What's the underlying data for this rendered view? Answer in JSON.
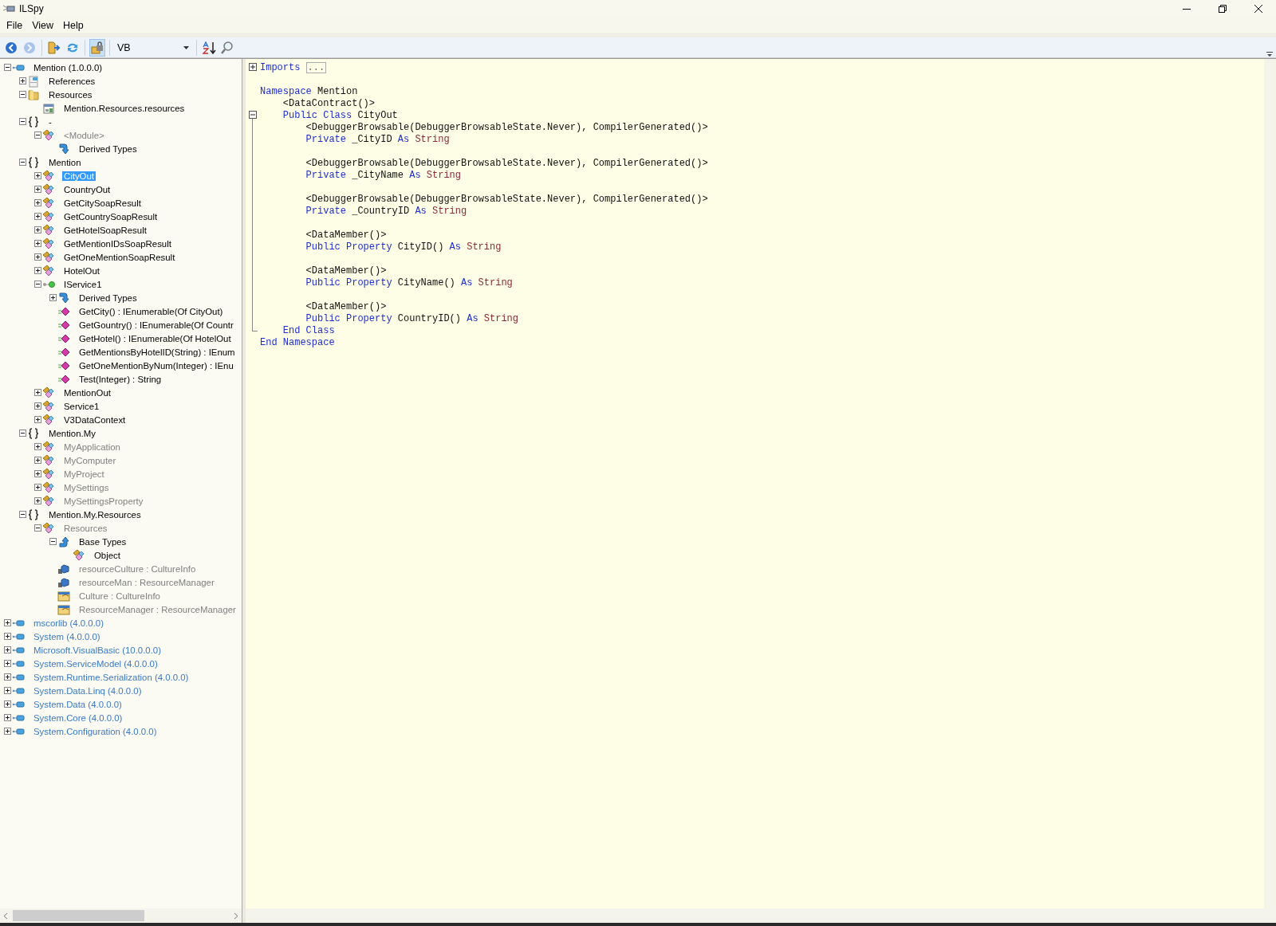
{
  "window": {
    "title": "ILSpy"
  },
  "menu": [
    "File",
    "View",
    "Help"
  ],
  "toolbar": {
    "buttons": [
      {
        "kind": "back",
        "disabled": false,
        "pressed": false
      },
      {
        "kind": "forward",
        "disabled": true,
        "pressed": false
      },
      {
        "kind": "open",
        "disabled": false,
        "pressed": false
      },
      {
        "kind": "refresh",
        "disabled": false,
        "pressed": false
      },
      {
        "kind": "lock",
        "disabled": false,
        "pressed": true
      },
      {
        "kind": "language"
      },
      {
        "kind": "sort",
        "disabled": false,
        "pressed": false
      },
      {
        "kind": "search",
        "disabled": false,
        "pressed": false
      }
    ],
    "language": "VB"
  },
  "tree": [
    {
      "label": "Mention (1.0.0.0)",
      "kind": "assembly",
      "dependency": false,
      "expanded": true,
      "selected": false,
      "children": [
        {
          "label": "References",
          "kind": "references",
          "dimmed": false,
          "expanded": false,
          "selected": false
        },
        {
          "label": "Resources",
          "kind": "folder",
          "dimmed": false,
          "expanded": true,
          "selected": false,
          "children": [
            {
              "label": "Mention.Resources.resources",
              "kind": "resource",
              "dimmed": false,
              "selected": false
            }
          ]
        },
        {
          "label": "-",
          "kind": "namespace",
          "dimmed": false,
          "expanded": true,
          "selected": false,
          "children": [
            {
              "label": "<Module>",
              "kind": "class",
              "dimmed": true,
              "expanded": true,
              "selected": false,
              "children": [
                {
                  "label": "Derived Types",
                  "kind": "derived",
                  "dimmed": false,
                  "selected": false
                }
              ]
            }
          ]
        },
        {
          "label": "Mention",
          "kind": "namespace",
          "dimmed": false,
          "expanded": true,
          "selected": false,
          "children": [
            {
              "label": "CityOut",
              "kind": "class",
              "dimmed": false,
              "expanded": false,
              "selected": true
            },
            {
              "label": "CountryOut",
              "kind": "class",
              "dimmed": false,
              "expanded": false,
              "selected": false
            },
            {
              "label": "GetCitySoapResult",
              "kind": "class",
              "dimmed": false,
              "expanded": false,
              "selected": false
            },
            {
              "label": "GetCountrySoapResult",
              "kind": "class",
              "dimmed": false,
              "expanded": false,
              "selected": false
            },
            {
              "label": "GetHotelSoapResult",
              "kind": "class",
              "dimmed": false,
              "expanded": false,
              "selected": false
            },
            {
              "label": "GetMentionIDsSoapResult",
              "kind": "class",
              "dimmed": false,
              "expanded": false,
              "selected": false
            },
            {
              "label": "GetOneMentionSoapResult",
              "kind": "class",
              "dimmed": false,
              "expanded": false,
              "selected": false
            },
            {
              "label": "HotelOut",
              "kind": "class",
              "dimmed": false,
              "expanded": false,
              "selected": false
            },
            {
              "label": "IService1",
              "kind": "interface",
              "dimmed": false,
              "expanded": true,
              "selected": false,
              "children": [
                {
                  "label": "Derived Types",
                  "kind": "derived",
                  "dimmed": false,
                  "expanded": false,
                  "selected": false
                },
                {
                  "label": "GetCity() : IEnumerable(Of CityOut)",
                  "kind": "method",
                  "dimmed": false,
                  "selected": false
                },
                {
                  "label": "GetGountry() : IEnumerable(Of Countr",
                  "kind": "method",
                  "dimmed": false,
                  "selected": false
                },
                {
                  "label": "GetHotel() : IEnumerable(Of HotelOut",
                  "kind": "method",
                  "dimmed": false,
                  "selected": false
                },
                {
                  "label": "GetMentionsByHotelID(String) : IEnum",
                  "kind": "method",
                  "dimmed": false,
                  "selected": false
                },
                {
                  "label": "GetOneMentionByNum(Integer) : IEnu",
                  "kind": "method",
                  "dimmed": false,
                  "selected": false
                },
                {
                  "label": "Test(Integer) : String",
                  "kind": "method",
                  "dimmed": false,
                  "selected": false
                }
              ]
            },
            {
              "label": "MentionOut",
              "kind": "class",
              "dimmed": false,
              "expanded": false,
              "selected": false
            },
            {
              "label": "Service1",
              "kind": "class",
              "dimmed": false,
              "expanded": false,
              "selected": false
            },
            {
              "label": "V3DataContext",
              "kind": "class",
              "dimmed": false,
              "expanded": false,
              "selected": false
            }
          ]
        },
        {
          "label": "Mention.My",
          "kind": "namespace",
          "dimmed": false,
          "expanded": true,
          "selected": false,
          "children": [
            {
              "label": "MyApplication",
              "kind": "class",
              "dimmed": true,
              "expanded": false,
              "selected": false
            },
            {
              "label": "MyComputer",
              "kind": "class",
              "dimmed": true,
              "expanded": false,
              "selected": false
            },
            {
              "label": "MyProject",
              "kind": "class",
              "dimmed": true,
              "expanded": false,
              "selected": false
            },
            {
              "label": "MySettings",
              "kind": "class",
              "dimmed": true,
              "expanded": false,
              "selected": false
            },
            {
              "label": "MySettingsProperty",
              "kind": "class",
              "dimmed": true,
              "expanded": false,
              "selected": false
            }
          ]
        },
        {
          "label": "Mention.My.Resources",
          "kind": "namespace",
          "dimmed": false,
          "expanded": true,
          "selected": false,
          "children": [
            {
              "label": "Resources",
              "kind": "class",
              "dimmed": true,
              "expanded": true,
              "selected": false,
              "children": [
                {
                  "label": "Base Types",
                  "kind": "base",
                  "dimmed": false,
                  "expanded": true,
                  "selected": false,
                  "children": [
                    {
                      "label": "Object",
                      "kind": "class",
                      "dimmed": false,
                      "selected": false
                    }
                  ]
                },
                {
                  "label": "resourceCulture : CultureInfo",
                  "kind": "field",
                  "dimmed": true,
                  "selected": false
                },
                {
                  "label": "resourceMan : ResourceManager",
                  "kind": "field",
                  "dimmed": true,
                  "selected": false
                },
                {
                  "label": "Culture : CultureInfo",
                  "kind": "property",
                  "dimmed": true,
                  "selected": false
                },
                {
                  "label": "ResourceManager : ResourceManager",
                  "kind": "property",
                  "dimmed": true,
                  "selected": false
                }
              ]
            }
          ]
        }
      ]
    },
    {
      "label": "mscorlib (4.0.0.0)",
      "kind": "assembly",
      "dependency": true,
      "expanded": false,
      "selected": false
    },
    {
      "label": "System (4.0.0.0)",
      "kind": "assembly",
      "dependency": true,
      "expanded": false,
      "selected": false
    },
    {
      "label": "Microsoft.VisualBasic (10.0.0.0)",
      "kind": "assembly",
      "dependency": true,
      "expanded": false,
      "selected": false
    },
    {
      "label": "System.ServiceModel (4.0.0.0)",
      "kind": "assembly",
      "dependency": true,
      "expanded": false,
      "selected": false
    },
    {
      "label": "System.Runtime.Serialization (4.0.0.0)",
      "kind": "assembly",
      "dependency": true,
      "expanded": false,
      "selected": false
    },
    {
      "label": "System.Data.Linq (4.0.0.0)",
      "kind": "assembly",
      "dependency": true,
      "expanded": false,
      "selected": false
    },
    {
      "label": "System.Data (4.0.0.0)",
      "kind": "assembly",
      "dependency": true,
      "expanded": false,
      "selected": false
    },
    {
      "label": "System.Core (4.0.0.0)",
      "kind": "assembly",
      "dependency": true,
      "expanded": false,
      "selected": false
    },
    {
      "label": "System.Configuration (4.0.0.0)",
      "kind": "assembly",
      "dependency": true,
      "expanded": false,
      "selected": false
    }
  ],
  "code": [
    {
      "kind": "code",
      "expanded": false,
      "tokens": [
        {
          "kind": "kw",
          "text": "Imports"
        },
        {
          "kind": "box",
          "text": "..."
        }
      ]
    },
    {
      "kind": "blank"
    },
    {
      "kind": "code",
      "tokens": [
        {
          "kind": "kw",
          "text": "Namespace"
        },
        {
          "kind": "plain",
          "text": "Mention"
        }
      ],
      "children": [
        {
          "kind": "code",
          "tokens": [
            {
              "kind": "plain",
              "text": "<DataContract()>"
            }
          ]
        },
        {
          "kind": "code",
          "expanded": true,
          "tokens": [
            {
              "kind": "kw",
              "text": "Public Class"
            },
            {
              "kind": "plain",
              "text": "CityOut"
            }
          ],
          "children": [
            {
              "kind": "code",
              "tokens": [
                {
                  "kind": "plain",
                  "text": "<DebuggerBrowsable(DebuggerBrowsableState.Never), CompilerGenerated()>"
                }
              ]
            },
            {
              "kind": "code",
              "tokens": [
                {
                  "kind": "kw",
                  "text": "Private"
                },
                {
                  "kind": "plain",
                  "text": "_CityID"
                },
                {
                  "kind": "kw",
                  "text": "As"
                },
                {
                  "kind": "type",
                  "text": "String"
                }
              ]
            },
            {
              "kind": "blank"
            },
            {
              "kind": "code",
              "tokens": [
                {
                  "kind": "plain",
                  "text": "<DebuggerBrowsable(DebuggerBrowsableState.Never), CompilerGenerated()>"
                }
              ]
            },
            {
              "kind": "code",
              "tokens": [
                {
                  "kind": "kw",
                  "text": "Private"
                },
                {
                  "kind": "plain",
                  "text": "_CityName"
                },
                {
                  "kind": "kw",
                  "text": "As"
                },
                {
                  "kind": "type",
                  "text": "String"
                }
              ]
            },
            {
              "kind": "blank"
            },
            {
              "kind": "code",
              "tokens": [
                {
                  "kind": "plain",
                  "text": "<DebuggerBrowsable(DebuggerBrowsableState.Never), CompilerGenerated()>"
                }
              ]
            },
            {
              "kind": "code",
              "tokens": [
                {
                  "kind": "kw",
                  "text": "Private"
                },
                {
                  "kind": "plain",
                  "text": "_CountryID"
                },
                {
                  "kind": "kw",
                  "text": "As"
                },
                {
                  "kind": "type",
                  "text": "String"
                }
              ]
            },
            {
              "kind": "blank"
            },
            {
              "kind": "code",
              "tokens": [
                {
                  "kind": "plain",
                  "text": "<DataMember()>"
                }
              ]
            },
            {
              "kind": "code",
              "tokens": [
                {
                  "kind": "kw",
                  "text": "Public Property"
                },
                {
                  "kind": "plain",
                  "text": "CityID()"
                },
                {
                  "kind": "kw",
                  "text": "As"
                },
                {
                  "kind": "type",
                  "text": "String"
                }
              ]
            },
            {
              "kind": "blank"
            },
            {
              "kind": "code",
              "tokens": [
                {
                  "kind": "plain",
                  "text": "<DataMember()>"
                }
              ]
            },
            {
              "kind": "code",
              "tokens": [
                {
                  "kind": "kw",
                  "text": "Public Property"
                },
                {
                  "kind": "plain",
                  "text": "CityName()"
                },
                {
                  "kind": "kw",
                  "text": "As"
                },
                {
                  "kind": "type",
                  "text": "String"
                }
              ]
            },
            {
              "kind": "blank"
            },
            {
              "kind": "code",
              "tokens": [
                {
                  "kind": "plain",
                  "text": "<DataMember()>"
                }
              ]
            },
            {
              "kind": "code",
              "tokens": [
                {
                  "kind": "kw",
                  "text": "Public Property"
                },
                {
                  "kind": "plain",
                  "text": "CountryID()"
                },
                {
                  "kind": "kw",
                  "text": "As"
                },
                {
                  "kind": "type",
                  "text": "String"
                }
              ]
            }
          ]
        },
        {
          "kind": "code",
          "tokens": [
            {
              "kind": "kw",
              "text": "End Class"
            }
          ]
        }
      ]
    },
    {
      "kind": "code",
      "tokens": [
        {
          "kind": "kw",
          "text": "End Namespace"
        }
      ]
    }
  ]
}
